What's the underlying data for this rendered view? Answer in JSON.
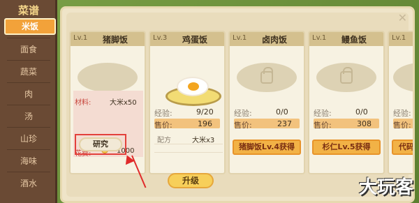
{
  "sidebar": {
    "title": "菜谱",
    "items": [
      "米饭",
      "面食",
      "蔬菜",
      "肉",
      "汤",
      "山珍",
      "海味",
      "酒水"
    ],
    "active_index": 0
  },
  "cards": [
    {
      "level": "Lv.1",
      "name": "猪脚饭",
      "material_label": "材料:",
      "material_value": "大米x50",
      "cost_label": "花费:",
      "cost_value": "1000",
      "research_label": "研究"
    },
    {
      "level": "Lv.3",
      "name": "鸡蛋饭",
      "exp_label": "经验:",
      "exp_value": "9/20",
      "price_label": "售价:",
      "price_value": "196",
      "config_label": "配方",
      "config_value": "大米x3"
    },
    {
      "level": "Lv.1",
      "name": "卤肉饭",
      "exp_label": "经验:",
      "exp_value": "0/0",
      "price_label": "售价:",
      "price_value": "237",
      "unlock_label": "猪脚饭Lv.4获得"
    },
    {
      "level": "Lv.1",
      "name": "鳗鱼饭",
      "exp_label": "经验:",
      "exp_value": "0/0",
      "price_label": "售价:",
      "price_value": "308",
      "unlock_label": "杉仁Lv.5获得"
    },
    {
      "level": "Lv.1",
      "name": "",
      "exp_label": "经验:",
      "price_label": "售价:",
      "unlock_label": "代码"
    }
  ],
  "upgrade_label": "升级",
  "close_icon": "close-icon",
  "watermark": "大玩客",
  "colors": {
    "accent": "#f2a23a",
    "highlight": "#e3413c"
  }
}
